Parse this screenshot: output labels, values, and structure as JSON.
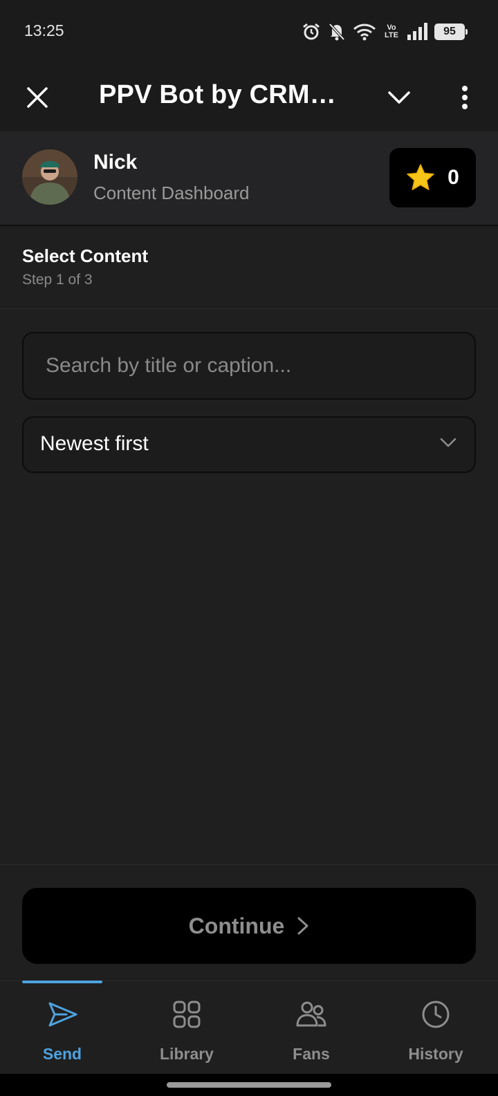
{
  "status_bar": {
    "time": "13:25",
    "volte_top": "Vo",
    "volte_bottom": "LTE",
    "battery": "95",
    "icons": [
      "alarm-icon",
      "bell-muted-icon",
      "wifi-icon",
      "volte-icon",
      "signal-icon",
      "battery-icon"
    ]
  },
  "header": {
    "title": "PPV Bot by CRMC...",
    "icons": [
      "close-icon",
      "chevron-down-icon",
      "more-vertical-icon"
    ]
  },
  "profile": {
    "name": "Nick",
    "subtitle": "Content Dashboard",
    "stars": "0"
  },
  "step": {
    "title": "Select Content",
    "subtitle": "Step 1 of 3"
  },
  "search": {
    "placeholder": "Search by title or caption...",
    "value": ""
  },
  "sort": {
    "selected": "Newest first"
  },
  "footer": {
    "continue_label": "Continue"
  },
  "nav": {
    "items": [
      {
        "label": "Send",
        "icon": "send-icon",
        "active": true
      },
      {
        "label": "Library",
        "icon": "grid-icon",
        "active": false
      },
      {
        "label": "Fans",
        "icon": "users-icon",
        "active": false
      },
      {
        "label": "History",
        "icon": "clock-icon",
        "active": false
      }
    ]
  },
  "colors": {
    "accent": "#4ea3e0",
    "background": "#1f1f1f",
    "card": "#242426",
    "star": "#f5c518"
  }
}
